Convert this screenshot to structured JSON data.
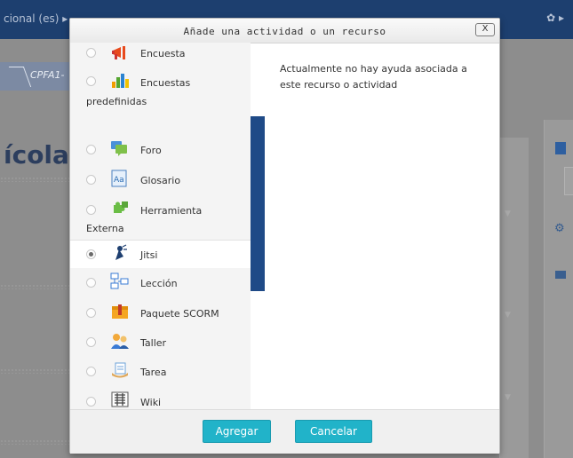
{
  "background": {
    "language": "cional (es)",
    "crumb": "CPFA1-",
    "title": "ícola"
  },
  "modal": {
    "title": "Añade una actividad o un recurso",
    "close_label": "X",
    "help": "Actualmente no hay ayuda asociada a este recurso o actividad",
    "options": [
      {
        "label": "Encuesta",
        "selected": false,
        "icon": "megaphone-icon"
      },
      {
        "label": "Encuestas",
        "label2": "predefinidas",
        "selected": false,
        "icon": "bar-chart-icon"
      },
      {
        "label": "Foro",
        "selected": false,
        "icon": "forum-icon"
      },
      {
        "label": "Glosario",
        "selected": false,
        "icon": "glossary-icon"
      },
      {
        "label": "Herramienta",
        "label2": "Externa",
        "selected": false,
        "icon": "puzzle-icon"
      },
      {
        "label": "Jitsi",
        "selected": true,
        "icon": "jitsi-icon"
      },
      {
        "label": "Lección",
        "selected": false,
        "icon": "lesson-icon"
      },
      {
        "label": "Paquete SCORM",
        "selected": false,
        "icon": "scorm-package-icon"
      },
      {
        "label": "Taller",
        "selected": false,
        "icon": "workshop-icon"
      },
      {
        "label": "Tarea",
        "selected": false,
        "icon": "assignment-icon"
      },
      {
        "label": "Wiki",
        "selected": false,
        "icon": "wiki-icon"
      }
    ],
    "buttons": {
      "add": "Agregar",
      "cancel": "Cancelar"
    }
  },
  "colors": {
    "accent": "#21b3c9",
    "navbar": "#1d3f6f",
    "scroll_accent": "#1f4a87"
  }
}
